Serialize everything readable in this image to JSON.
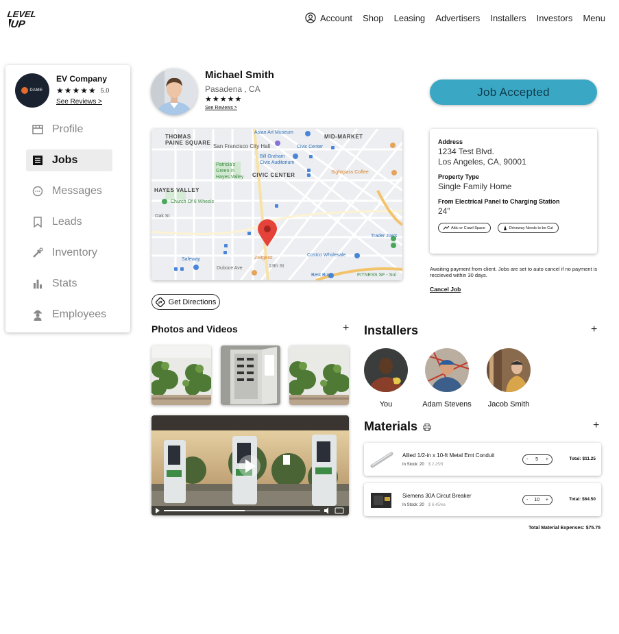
{
  "header": {
    "logo_text": "LEVEL UP",
    "nav": [
      {
        "label": "Account",
        "icon": "account-icon"
      },
      {
        "label": "Shop"
      },
      {
        "label": "Leasing"
      },
      {
        "label": "Advertisers"
      },
      {
        "label": "Installers"
      },
      {
        "label": "Investors"
      },
      {
        "label": "Menu"
      }
    ]
  },
  "sidebar": {
    "company_name": "EV Company",
    "company_logo_text": "DAME",
    "rating_stars": "★★★★★",
    "rating_value": "5.0",
    "see_reviews": "See Reviews >",
    "items": [
      {
        "label": "Profile",
        "icon": "store-icon",
        "active": false
      },
      {
        "label": "Jobs",
        "icon": "list-icon",
        "active": true
      },
      {
        "label": "Messages",
        "icon": "chat-icon",
        "active": false
      },
      {
        "label": "Leads",
        "icon": "bookmark-icon",
        "active": false
      },
      {
        "label": "Inventory",
        "icon": "tools-icon",
        "active": false
      },
      {
        "label": "Stats",
        "icon": "bar-chart-icon",
        "active": false
      },
      {
        "label": "Employees",
        "icon": "worker-icon",
        "active": false
      }
    ]
  },
  "client": {
    "name": "Michael Smith",
    "location": "Pasadena , CA",
    "stars": "★★★★★",
    "see_reviews": "See Reviews >"
  },
  "status": {
    "label": "Job Accepted",
    "color": "#3aa7c5"
  },
  "map": {
    "labels": {
      "thomas": "THOMAS\nPAINE SQUARE",
      "asian_art": "Asian Art Museum",
      "mid_market": "MID-MARKET",
      "city_hall": "San Francisco City Hall",
      "civic_center_station": "Civic Center",
      "bill_graham": "Bill Graham\nCivic Auditorium",
      "patricias": "Patricia's\nGreen in\nHayes Valley",
      "civic_center": "CIVIC CENTER",
      "sightglass": "Sightglass Coffee",
      "hayes_valley": "HAYES VALLEY",
      "church": "Church Of 8 Wheels",
      "oak": "Oak St",
      "trader": "Trader Joe's",
      "costco": "Costco Wholesale",
      "zeitgeist": "Zeitgeist",
      "safeway": "Safeway",
      "duboce": "Duboce Ave",
      "best_buy": "Best Buy",
      "fitness": "FITNESS SF - Soi",
      "thirteenth": "13th St"
    }
  },
  "directions_label": "Get Directions",
  "details": {
    "address_label": "Address",
    "address_line1": "1234 Test Blvd.",
    "address_line2": "Los Angeles, CA, 90001",
    "property_label": "Property Type",
    "property_value": "Single Family Home",
    "distance_label": "From Electrical Panel to Charging Station",
    "distance_value": "24”",
    "tags": [
      "Attic or Crawl Space",
      "Driveway Needs to be Cut"
    ]
  },
  "awaiting_text": "Awaiting payment from client. Jobs are set to auto cancel if no payment is reccieved within 30 days.",
  "cancel_label": "Cancel Job",
  "photos": {
    "title": "Photos and Videos",
    "add": "+"
  },
  "installers": {
    "title": "Installers",
    "add": "+",
    "people": [
      {
        "name": "You"
      },
      {
        "name": "Adam Stevens"
      },
      {
        "name": "Jacob Smith"
      }
    ]
  },
  "materials": {
    "title": "Materials",
    "add": "+",
    "items": [
      {
        "name": "Allied 1/2-in x 10-ft Metal Emt Conduit",
        "stock": "In Stock: 20",
        "unit_price": "$ 2.25/ft",
        "qty": "5",
        "minus": "-",
        "plus": "+",
        "total": "Total: $11.25"
      },
      {
        "name": "Siemens 30A Circut Breaker",
        "stock": "In Stock: 20",
        "unit_price": "$ 6.45/ea",
        "qty": "10",
        "minus": "-",
        "plus": "+",
        "total": "Total: $64.50"
      }
    ],
    "total_expenses": "Total Material Expenses: $75.75"
  }
}
